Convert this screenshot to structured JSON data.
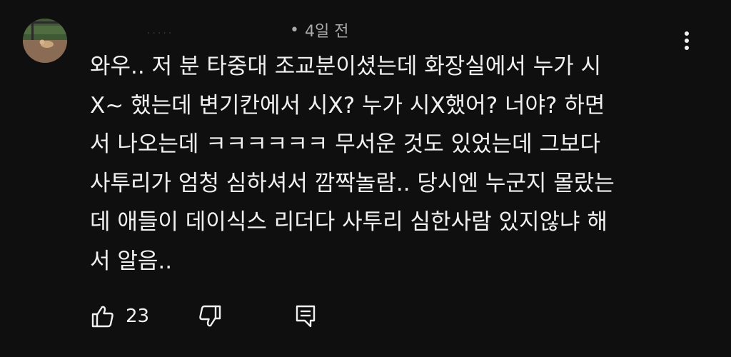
{
  "comment": {
    "author": "",
    "time": "4일 전",
    "separator": "•",
    "text_lines": [
      "와우.. 저 분 타중대 조교분이셨는데 화장실에서 누가 시",
      "X~ 했는데 변기칸에서 시X? 누가 시X했어? 너야? 하면",
      "서 나오는데 ㅋㅋㅋㅋㅋㅋ 무서운 것도 있었는데 그보다",
      "사투리가 엄청 심하셔서 깜짝놀람.. 당시엔 누군지 몰랐는",
      "데 애들이 데이식스 리더다 사투리 심한사람 있지않냐 해",
      "서 알음.."
    ],
    "like_count": "23"
  },
  "icons": {
    "avatar": "avatar-photo",
    "menu": "more-vertical-icon",
    "like": "thumbs-up-icon",
    "dislike": "thumbs-down-icon",
    "reply": "reply-comment-icon"
  },
  "colors": {
    "background": "#0f0f0f",
    "text": "#f1f1f1",
    "secondary_text": "#aaaaaa"
  }
}
